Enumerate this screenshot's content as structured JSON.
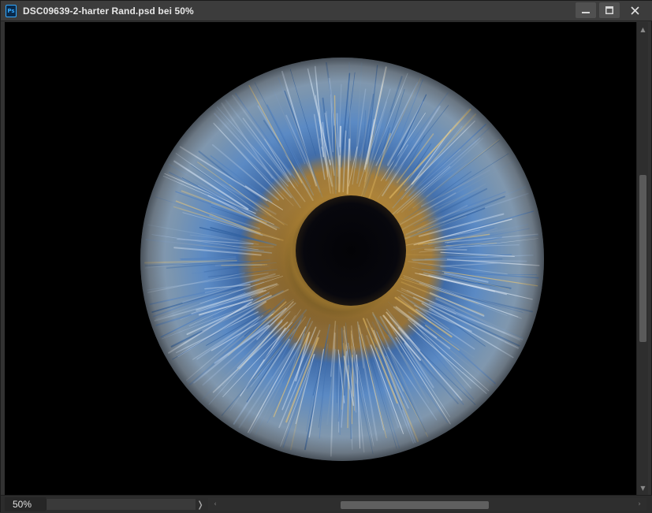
{
  "window": {
    "title": "DSC09639-2-harter Rand.psd bei 50%",
    "app_icon_label": "Ps",
    "controls": {
      "minimize_icon": "minimize-icon",
      "maximize_icon": "maximize-icon",
      "close_icon": "close-icon"
    }
  },
  "canvas": {
    "background": "#000000",
    "image_subject": "iris-eye-photo",
    "iris_colors": {
      "outer": "#5f7fa0",
      "blue": "#3d6fb0",
      "gold": "#c99a3a",
      "pupil": "#050509"
    }
  },
  "statusbar": {
    "zoom": "50%",
    "info_arrow": "❭"
  },
  "scrollbars": {
    "vertical_arrow_up": "▲",
    "vertical_arrow_down": "▼",
    "horizontal_arrow_left": "‹",
    "horizontal_arrow_right": "›"
  }
}
